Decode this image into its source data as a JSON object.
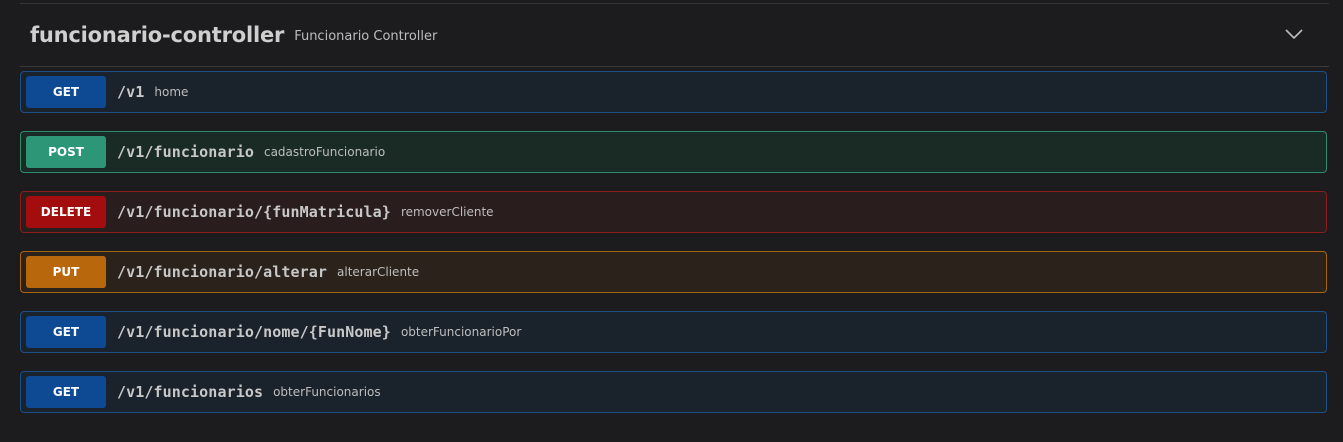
{
  "tag": {
    "name": "funcionario-controller",
    "description": "Funcionario Controller"
  },
  "operations": [
    {
      "method": "GET",
      "path": "/v1",
      "summary": "home"
    },
    {
      "method": "POST",
      "path": "/v1/funcionario",
      "summary": "cadastroFuncionario"
    },
    {
      "method": "DELETE",
      "path": "/v1/funcionario/{funMatricula}",
      "summary": "removerCliente"
    },
    {
      "method": "PUT",
      "path": "/v1/funcionario/alterar",
      "summary": "alterarCliente"
    },
    {
      "method": "GET",
      "path": "/v1/funcionario/nome/{FunNome}",
      "summary": "obterFuncionarioPor"
    },
    {
      "method": "GET",
      "path": "/v1/funcionarios",
      "summary": "obterFuncionarios"
    }
  ],
  "icons": {
    "collapse": "chevron-down-icon"
  },
  "colors": {
    "get": "#0d4a93",
    "post": "#2c9677",
    "delete": "#a30d0d",
    "put": "#b8670c"
  }
}
